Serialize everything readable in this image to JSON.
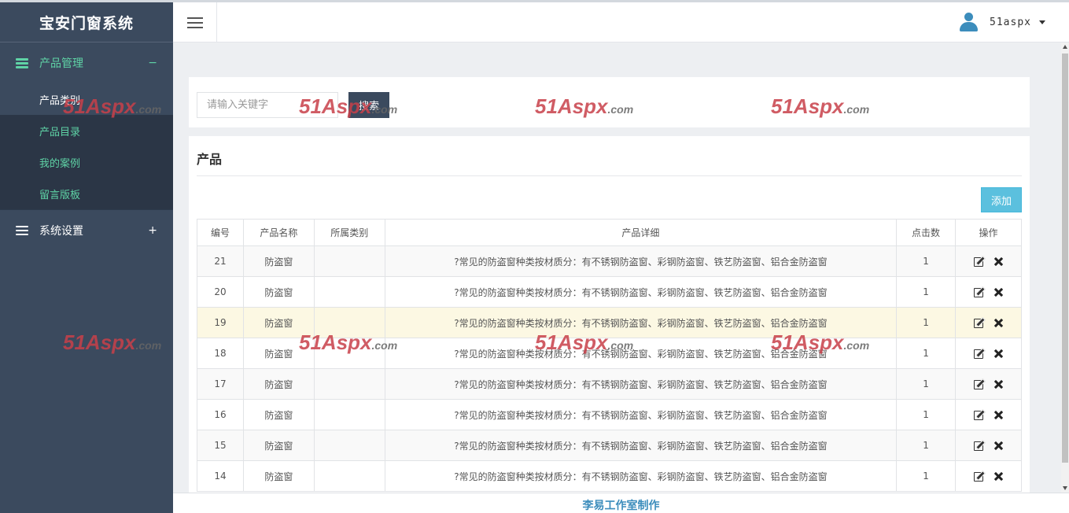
{
  "app": {
    "brand": "宝安门窗系统"
  },
  "sidebar": {
    "groups": [
      {
        "label": "产品管理",
        "toggle": "−",
        "items": [
          {
            "label": "产品类别"
          },
          {
            "label": "产品目录"
          },
          {
            "label": "我的案例"
          },
          {
            "label": "留言版板"
          }
        ]
      },
      {
        "label": "系统设置",
        "toggle": "+"
      }
    ]
  },
  "topbar": {
    "user": "51aspx"
  },
  "search": {
    "placeholder": "请输入关键字",
    "button": "搜索"
  },
  "panel": {
    "title": "产品",
    "add_label": "添加",
    "columns": [
      "编号",
      "产品名称",
      "所属类别",
      "产品详细",
      "点击数",
      "操作"
    ],
    "rows": [
      {
        "id": "21",
        "name": "防盗窗",
        "category": "",
        "detail": "?常见的防盗窗种类按材质分：有不锈钢防盗窗、彩钢防盗窗、铁艺防盗窗、铝合金防盗窗",
        "clicks": "1"
      },
      {
        "id": "20",
        "name": "防盗窗",
        "category": "",
        "detail": "?常见的防盗窗种类按材质分：有不锈钢防盗窗、彩钢防盗窗、铁艺防盗窗、铝合金防盗窗",
        "clicks": "1"
      },
      {
        "id": "19",
        "name": "防盗窗",
        "category": "",
        "detail": "?常见的防盗窗种类按材质分：有不锈钢防盗窗、彩钢防盗窗、铁艺防盗窗、铝合金防盗窗",
        "clicks": "1"
      },
      {
        "id": "18",
        "name": "防盗窗",
        "category": "",
        "detail": "?常见的防盗窗种类按材质分：有不锈钢防盗窗、彩钢防盗窗、铁艺防盗窗、铝合金防盗窗",
        "clicks": "1"
      },
      {
        "id": "17",
        "name": "防盗窗",
        "category": "",
        "detail": "?常见的防盗窗种类按材质分：有不锈钢防盗窗、彩钢防盗窗、铁艺防盗窗、铝合金防盗窗",
        "clicks": "1"
      },
      {
        "id": "16",
        "name": "防盗窗",
        "category": "",
        "detail": "?常见的防盗窗种类按材质分：有不锈钢防盗窗、彩钢防盗窗、铁艺防盗窗、铝合金防盗窗",
        "clicks": "1"
      },
      {
        "id": "15",
        "name": "防盗窗",
        "category": "",
        "detail": "?常见的防盗窗种类按材质分：有不锈钢防盗窗、彩钢防盗窗、铁艺防盗窗、铝合金防盗窗",
        "clicks": "1"
      },
      {
        "id": "14",
        "name": "防盗窗",
        "category": "",
        "detail": "?常见的防盗窗种类按材质分：有不锈钢防盗窗、彩钢防盗窗、铁艺防盗窗、铝合金防盗窗",
        "clicks": "1"
      }
    ]
  },
  "footer": {
    "text": "李易工作室制作"
  },
  "watermark": {
    "main": "51Aspx",
    "suffix": ".com"
  }
}
